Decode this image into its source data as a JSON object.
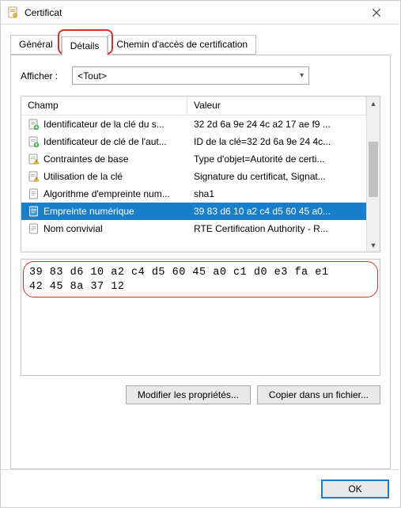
{
  "window": {
    "title": "Certificat",
    "close_tooltip": "Fermer"
  },
  "tabs": {
    "general": "Général",
    "details": "Détails",
    "certpath": "Chemin d'accès de certification",
    "active": "details"
  },
  "filter": {
    "label": "Afficher :",
    "value": "<Tout>"
  },
  "columns": {
    "field": "Champ",
    "value": "Valeur"
  },
  "rows": [
    {
      "icon": "ext-down",
      "field": "Identificateur de la clé du s...",
      "value": "32 2d 6a 9e 24 4c a2 17 ae f9 ..."
    },
    {
      "icon": "ext-down",
      "field": "Identificateur de clé de l'aut...",
      "value": "ID de la clé=32 2d 6a 9e 24 4c..."
    },
    {
      "icon": "ext-warn",
      "field": "Contraintes de base",
      "value": "Type d'objet=Autorité de certi..."
    },
    {
      "icon": "ext-warn",
      "field": "Utilisation de la clé",
      "value": "Signature du certificat, Signat..."
    },
    {
      "icon": "prop",
      "field": "Algorithme d'empreinte num...",
      "value": "sha1"
    },
    {
      "icon": "prop",
      "field": "Empreinte numérique",
      "value": "39 83 d6 10 a2 c4 d5 60 45 a0...",
      "selected": true
    },
    {
      "icon": "prop",
      "field": "Nom convivial",
      "value": "RTE Certification Authority - R..."
    }
  ],
  "detail_text": "39 83 d6 10 a2 c4 d5 60 45 a0 c1 d0 e3 fa e1\n42 45 8a 37 12",
  "buttons": {
    "edit_props": "Modifier les propriétés...",
    "copy_file": "Copier dans un fichier...",
    "ok": "OK"
  }
}
